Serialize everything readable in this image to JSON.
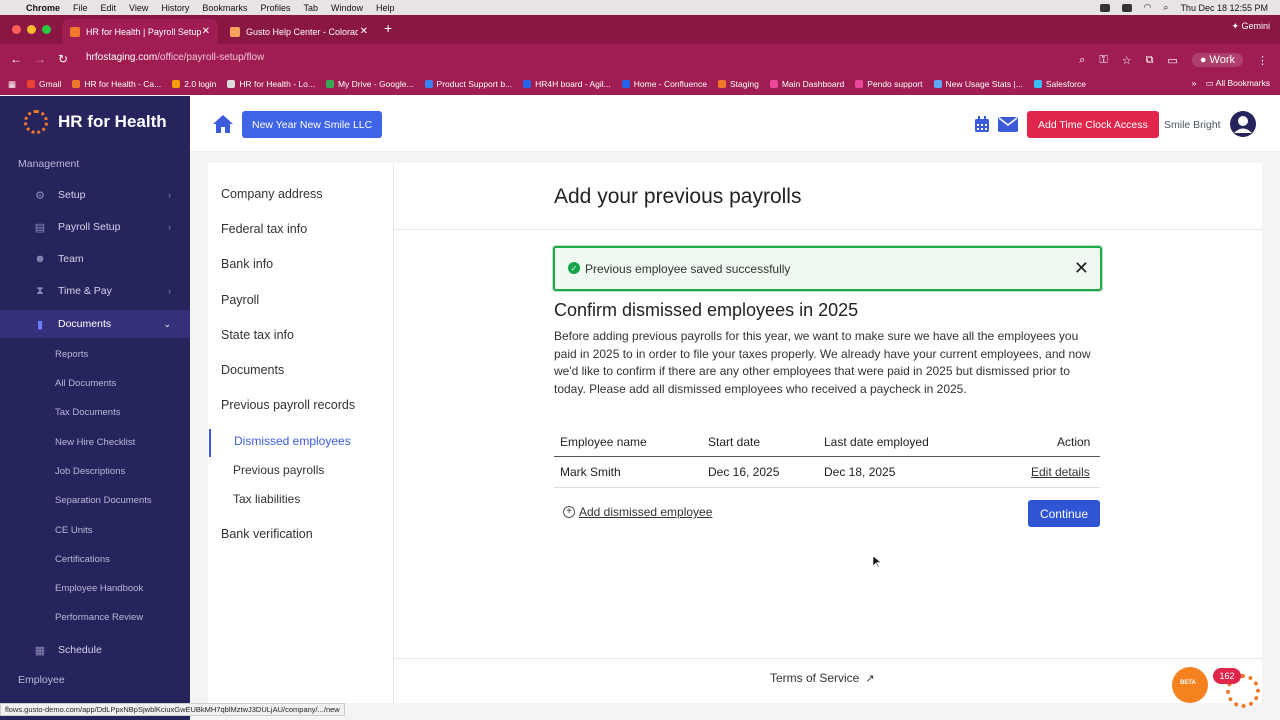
{
  "macos": {
    "menus": [
      "Chrome",
      "File",
      "Edit",
      "View",
      "History",
      "Bookmarks",
      "Profiles",
      "Tab",
      "Window",
      "Help"
    ],
    "datetime": "Thu Dec 18  12:55 PM"
  },
  "browser": {
    "tabs": [
      {
        "title": "HR for Health | Payroll Setup",
        "active": true
      },
      {
        "title": "Gusto Help Center - Colorado",
        "active": false
      }
    ],
    "gemini_label": "Gemini",
    "url_host": "hrfostaging.com",
    "url_path": "/office/payroll-setup/flow",
    "profile_label": "Work",
    "bookmarks": [
      "Gmail",
      "HR for Health - Ca...",
      "2.0 login",
      "HR for Health - Lo...",
      "My Drive - Google...",
      "Product Support b...",
      "HR4H board - Agil...",
      "Home - Confluence",
      "Staging",
      "Main Dashboard",
      "Pendo support",
      "New Usage Stats |...",
      "Salesforce"
    ],
    "all_bookmarks_label": "All Bookmarks",
    "status_url": "flows.gusto-demo.com/app/DdLPpxNBpSjwblKciuxGwEUBkMH7qblMztwJ3DULjAU/company/.../new"
  },
  "sidebar": {
    "logo_text": "HR for Health",
    "section_management": "Management",
    "items": [
      {
        "label": "Setup",
        "icon": "gear-icon"
      },
      {
        "label": "Payroll Setup",
        "icon": "document-icon"
      },
      {
        "label": "Team",
        "icon": "people-icon"
      },
      {
        "label": "Time & Pay",
        "icon": "hourglass-icon"
      },
      {
        "label": "Documents",
        "icon": "file-icon"
      }
    ],
    "sub_items": [
      "Reports",
      "All Documents",
      "Tax Documents",
      "New Hire Checklist",
      "Job Descriptions",
      "Separation Documents",
      "CE Units",
      "Certifications",
      "Employee Handbook",
      "Performance Review"
    ],
    "schedule_label": "Schedule",
    "section_employee": "Employee"
  },
  "header": {
    "company_button": "New Year New Smile LLC",
    "time_clock_button": "Add Time Clock Access",
    "user_name": "Smile Bright"
  },
  "steps": {
    "items": [
      "Company address",
      "Federal tax info",
      "Bank info",
      "Payroll",
      "State tax info",
      "Documents",
      "Previous payroll records"
    ],
    "sub_items": [
      "Dismissed employees",
      "Previous payrolls",
      "Tax liabilities"
    ],
    "last_item": "Bank verification"
  },
  "main": {
    "page_title": "Add your previous payrolls",
    "alert_text": "Previous employee saved successfully",
    "section_title": "Confirm dismissed employees in 2025",
    "description": "Before adding previous payrolls for this year, we want to make sure we have all the employees you paid in 2025 to in order to file your taxes properly. We already have your current employees, and now we'd like to confirm if there are any other employees that were paid in 2025 but dismissed prior to today. Please add all dismissed employees who received a paycheck in 2025.",
    "table": {
      "headers": [
        "Employee name",
        "Start date",
        "Last date employed",
        "Action"
      ],
      "rows": [
        {
          "name": "Mark Smith",
          "start": "Dec 16, 2025",
          "last": "Dec 18, 2025",
          "action": "Edit details"
        }
      ]
    },
    "add_link": "Add dismissed employee",
    "continue_button": "Continue",
    "terms_link": "Terms of Service"
  },
  "widgets": {
    "notification_count": "162",
    "beta_label": "BETA"
  },
  "colors": {
    "browser_chrome": "#a01d52",
    "sidebar": "#26245c",
    "primary_button": "#2f55d4",
    "danger_button": "#e1264b",
    "success": "#22a84a"
  }
}
